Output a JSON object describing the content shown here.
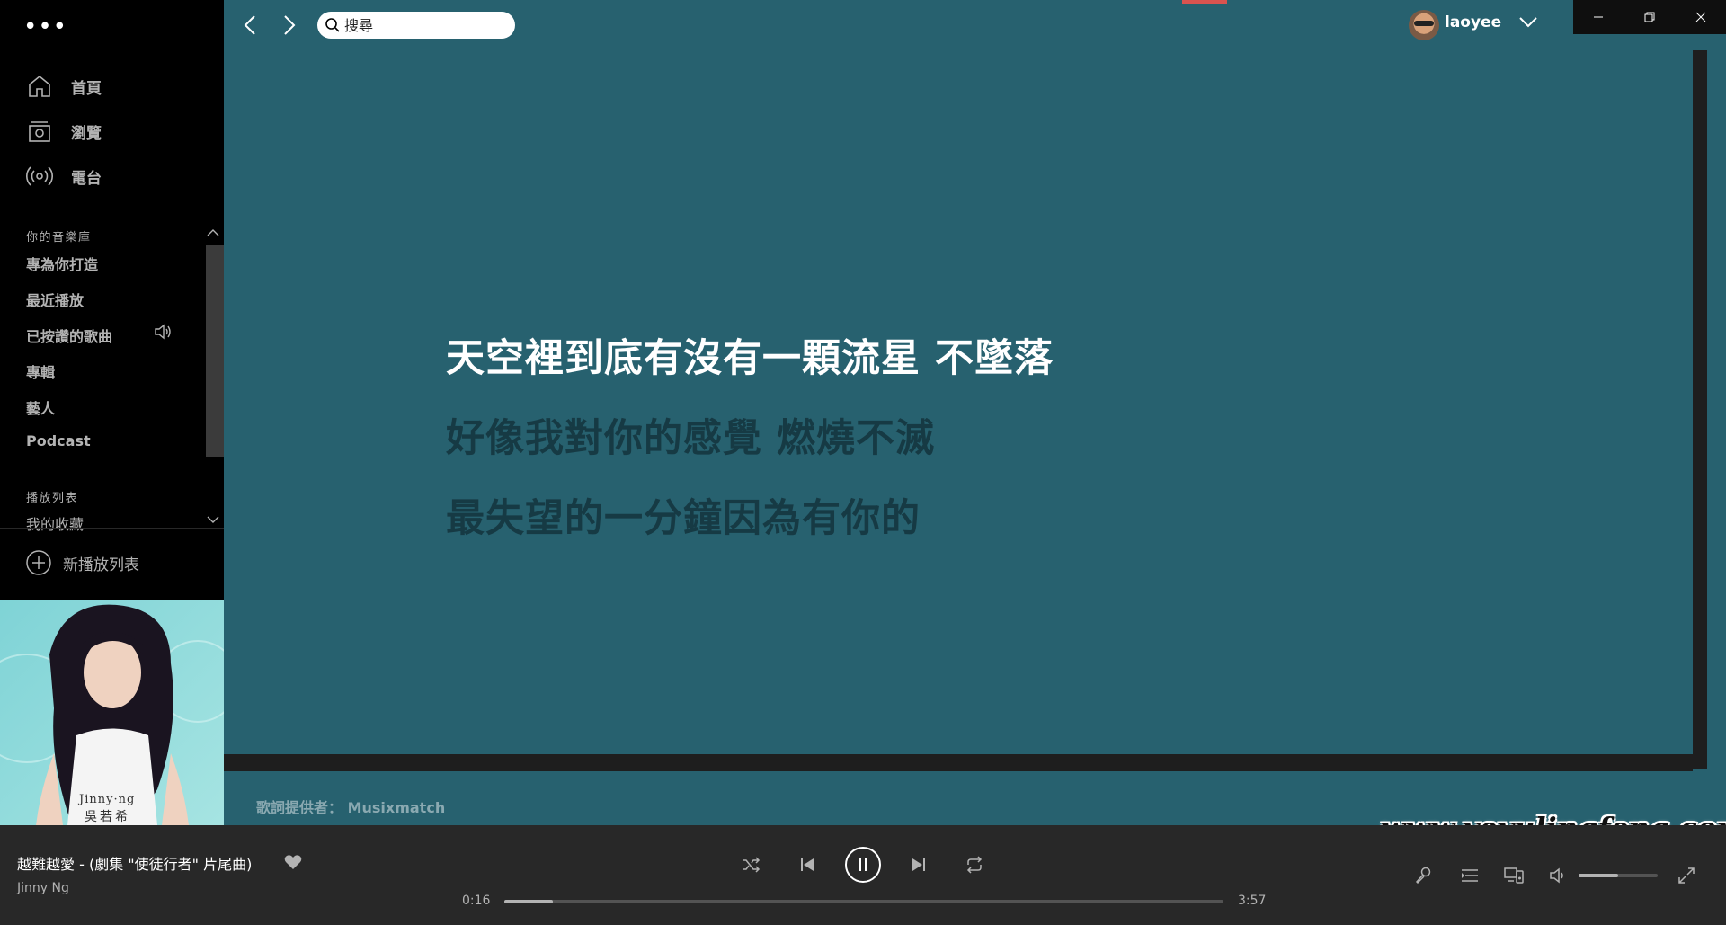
{
  "menu": {
    "dots": "•••"
  },
  "sidebar": {
    "nav": [
      {
        "label": "首頁",
        "icon": "home-icon"
      },
      {
        "label": "瀏覽",
        "icon": "browse-icon"
      },
      {
        "label": "電台",
        "icon": "radio-icon"
      }
    ],
    "library_label": "你的音樂庫",
    "library_items": [
      "專為你打造",
      "最近播放",
      "已按讚的歌曲",
      "專輯",
      "藝人",
      "Podcast"
    ],
    "playing_indicator_item": "已按讚的歌曲",
    "playlists_label": "播放列表",
    "playlists": [
      "我的收藏"
    ],
    "new_playlist": "新播放列表"
  },
  "cover": {
    "artist_text": "Jinny·ng",
    "chinese_name": "吳若希"
  },
  "topbar": {
    "search_placeholder": "搜尋",
    "username": "laoyee"
  },
  "lyrics": {
    "lines": [
      {
        "text": "天空裡到底有沒有一顆流星 不墜落",
        "active": true
      },
      {
        "text": "好像我對你的感覺 燃燒不滅",
        "active": false
      },
      {
        "text": "最失望的一分鐘因為有你的",
        "active": false
      }
    ],
    "credit": "歌詞提供者： Musixmatch"
  },
  "watermark": "www.yeyulingfeng.com",
  "player": {
    "title": "越難越愛 - (劇集 \"使徒行者\" 片尾曲)",
    "artist": "Jinny Ng",
    "elapsed": "0:16",
    "duration": "3:57",
    "progress_fraction": 0.0675,
    "volume_fraction": 0.5,
    "liked": true
  },
  "colors": {
    "background": "#121212",
    "sidebar": "#000000",
    "lyrics_bg": "#27616f",
    "lyric_active": "#ffffff",
    "lyric_inactive": "#163a44",
    "player_bar": "#282828"
  }
}
